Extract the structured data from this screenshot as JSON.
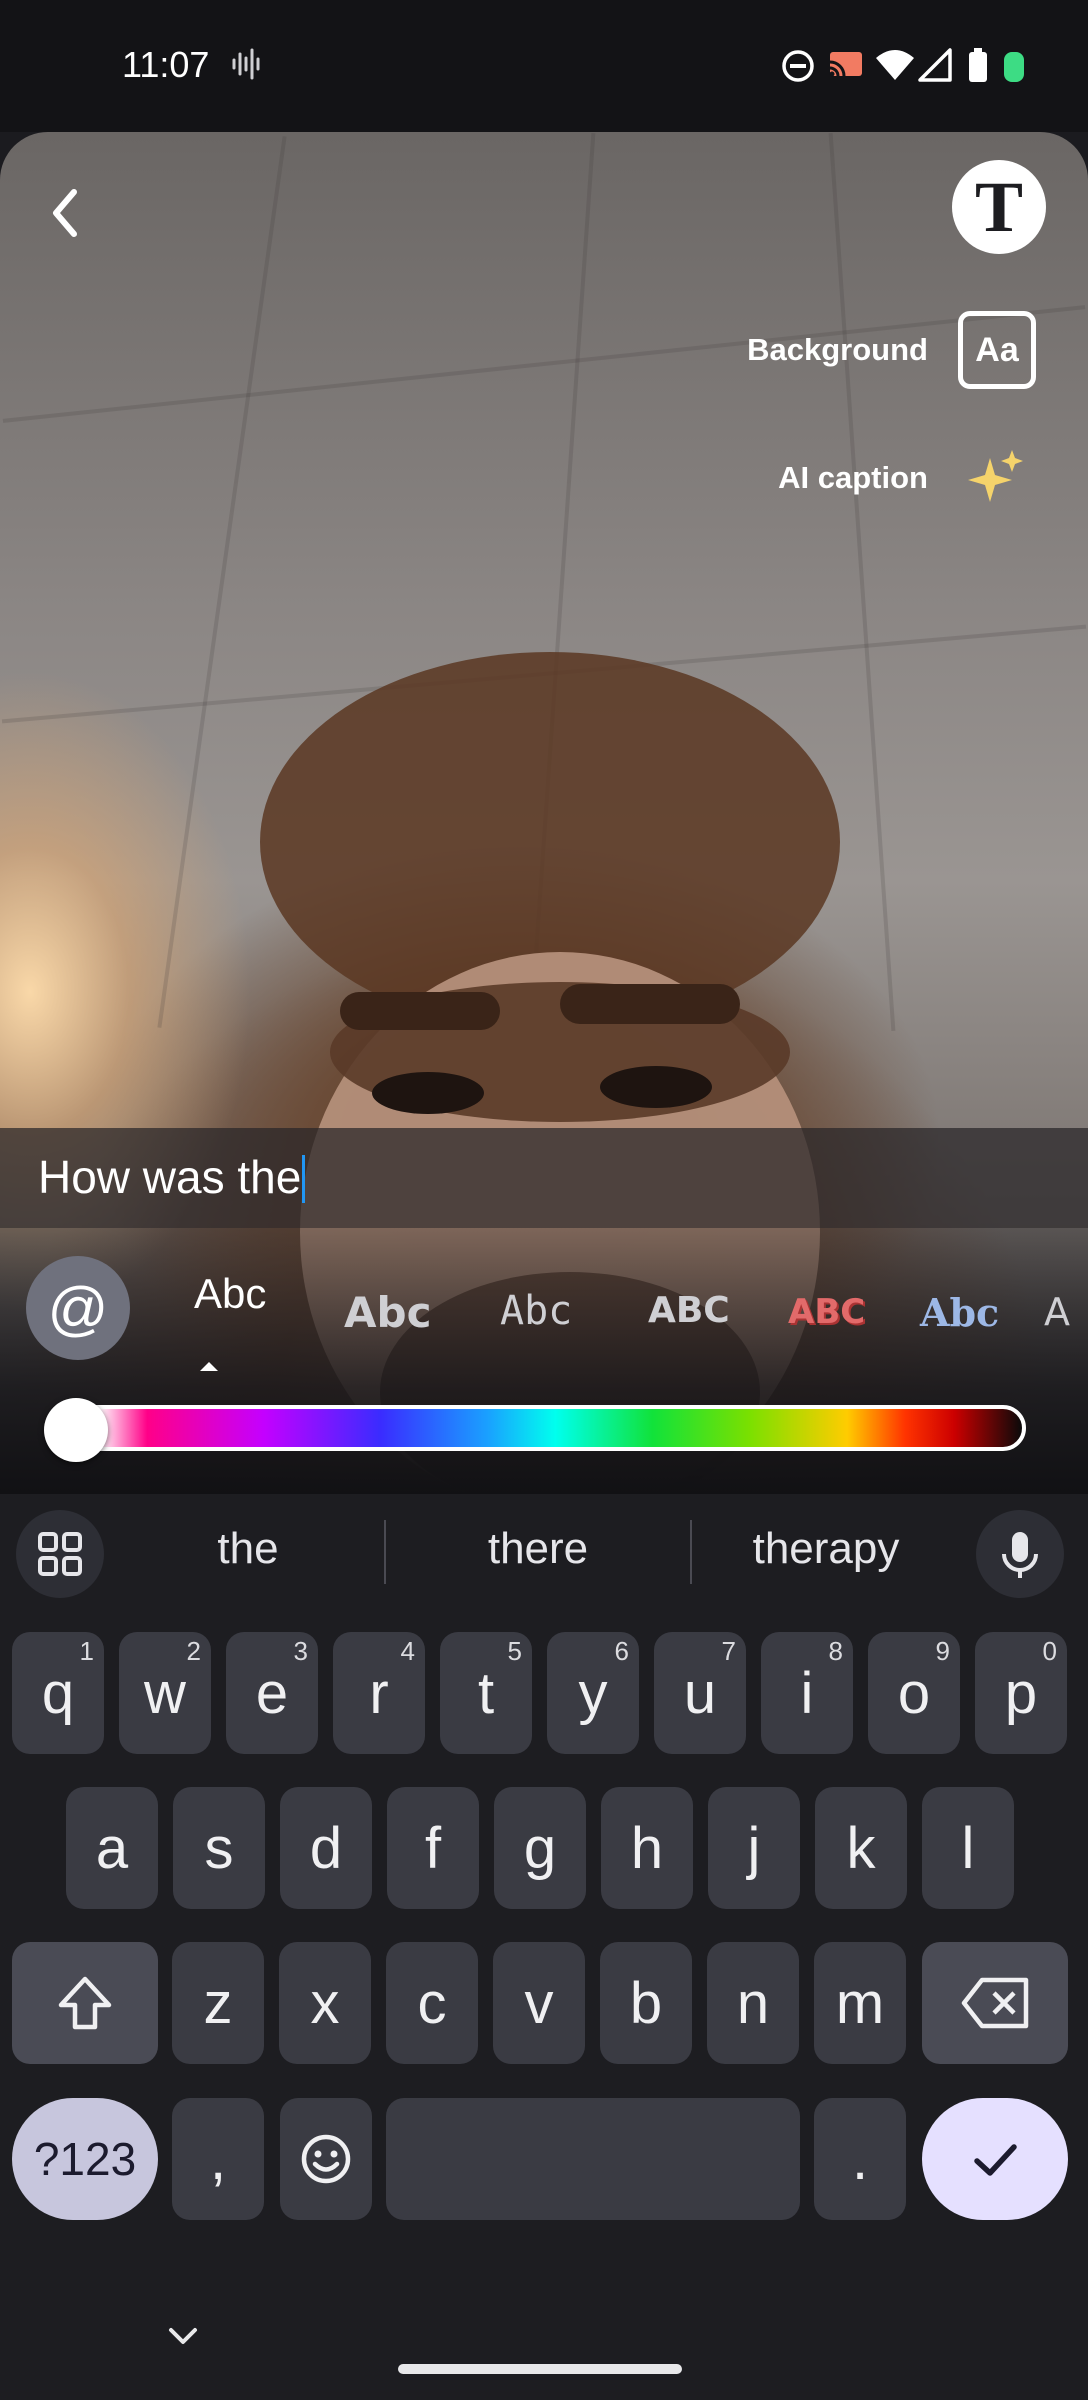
{
  "status_bar": {
    "time": "11:07",
    "icons": [
      "voice-wave-icon",
      "do-not-disturb-icon",
      "cast-icon",
      "wifi-icon",
      "signal-icon",
      "battery-icon",
      "battery-dot-icon"
    ]
  },
  "editor": {
    "text_tool_icon": "T",
    "background_label": "Background",
    "background_icon_text": "Aa",
    "ai_caption_label": "AI caption",
    "caption_text": "How was the"
  },
  "font_strip": {
    "at_symbol": "@",
    "fonts": [
      "Abc",
      "Abc",
      "Abc",
      "ABC",
      "ABC",
      "Abc",
      "A"
    ],
    "selected_index": 0
  },
  "color_slider": {
    "value": 0,
    "colors": [
      "#ffffff",
      "#ff0088",
      "#c400ff",
      "#3a2cff",
      "#1aa0ff",
      "#00ffee",
      "#11e23a",
      "#7be000",
      "#ffcc00",
      "#ff3300",
      "#cc0000",
      "#0a0a0a"
    ]
  },
  "keyboard": {
    "suggestions": [
      "the",
      "there",
      "therapy"
    ],
    "row1": [
      {
        "k": "q",
        "n": "1"
      },
      {
        "k": "w",
        "n": "2"
      },
      {
        "k": "e",
        "n": "3"
      },
      {
        "k": "r",
        "n": "4"
      },
      {
        "k": "t",
        "n": "5"
      },
      {
        "k": "y",
        "n": "6"
      },
      {
        "k": "u",
        "n": "7"
      },
      {
        "k": "i",
        "n": "8"
      },
      {
        "k": "o",
        "n": "9"
      },
      {
        "k": "p",
        "n": "0"
      }
    ],
    "row2": [
      "a",
      "s",
      "d",
      "f",
      "g",
      "h",
      "j",
      "k",
      "l"
    ],
    "row3": [
      "z",
      "x",
      "c",
      "v",
      "b",
      "n",
      "m"
    ],
    "symbols_label": "?123",
    "comma": ",",
    "period": "."
  }
}
